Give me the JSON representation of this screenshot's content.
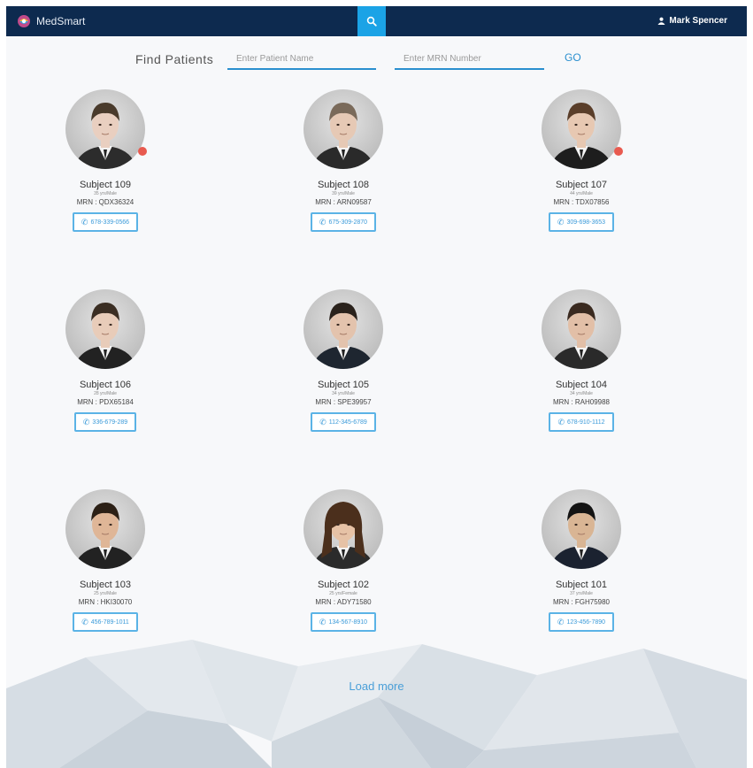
{
  "app": {
    "name": "MedSmart"
  },
  "header": {
    "user_name": "Mark Spencer"
  },
  "search": {
    "label": "Find Patients",
    "name_placeholder": "Enter Patient Name",
    "mrn_placeholder": "Enter MRN Number",
    "go_label": "GO"
  },
  "patients": [
    {
      "name": "Subject 109",
      "meta": "35 yrs/Male",
      "mrn": "MRN : QDX36324",
      "phone": "678-339-0566",
      "alert": true,
      "suit": "#2c2c2c",
      "hair": "#4a3b2c",
      "skin": "#e9cfc0"
    },
    {
      "name": "Subject 108",
      "meta": "39 yrs/Male",
      "mrn": "MRN : ARN09587",
      "phone": "675-309-2870",
      "alert": false,
      "suit": "#2a2a2a",
      "hair": "#7a6a5a",
      "skin": "#e6c9b5"
    },
    {
      "name": "Subject 107",
      "meta": "44 yrs/Male",
      "mrn": "MRN : TDX07856",
      "phone": "309-698-3653",
      "alert": true,
      "suit": "#1d1d1d",
      "hair": "#5a3e2a",
      "skin": "#e7c8b2"
    },
    {
      "name": "Subject 106",
      "meta": "28 yrs/Male",
      "mrn": "MRN : PDX65184",
      "phone": "336-679-289",
      "alert": false,
      "suit": "#222222",
      "hair": "#3b2e23",
      "skin": "#e8ccb9"
    },
    {
      "name": "Subject 105",
      "meta": "34 yrs/Male",
      "mrn": "MRN : SPE39957",
      "phone": "112-345-6789",
      "alert": false,
      "suit": "#1e2630",
      "hair": "#2a221c",
      "skin": "#e3c3ad"
    },
    {
      "name": "Subject 104",
      "meta": "34 yrs/Male",
      "mrn": "MRN : RAH09988",
      "phone": "678-910-1112",
      "alert": false,
      "suit": "#2a2a2a",
      "hair": "#3a2a20",
      "skin": "#e2bfa7"
    },
    {
      "name": "Subject 103",
      "meta": "25 yrs/Male",
      "mrn": "MRN : HKI30070",
      "phone": "456-789-1011",
      "alert": false,
      "suit": "#222222",
      "hair": "#2c2016",
      "skin": "#dfb697"
    },
    {
      "name": "Subject 102",
      "meta": "25 yrs/Female",
      "mrn": "MRN : ADY71580",
      "phone": "134-567-8910",
      "alert": false,
      "suit": "#2b2b2b",
      "hair": "#4b2f1c",
      "skin": "#e6c2a6"
    },
    {
      "name": "Subject 101",
      "meta": "37 yrs/Male",
      "mrn": "MRN : FGH75980",
      "phone": "123-456-7890",
      "alert": false,
      "suit": "#1b2230",
      "hair": "#141414",
      "skin": "#d9b594"
    }
  ],
  "load_more_label": "Load more",
  "colors": {
    "topbar": "#0d2a4f",
    "accent": "#1ba3e6",
    "alert_dot": "#e85a4f"
  }
}
